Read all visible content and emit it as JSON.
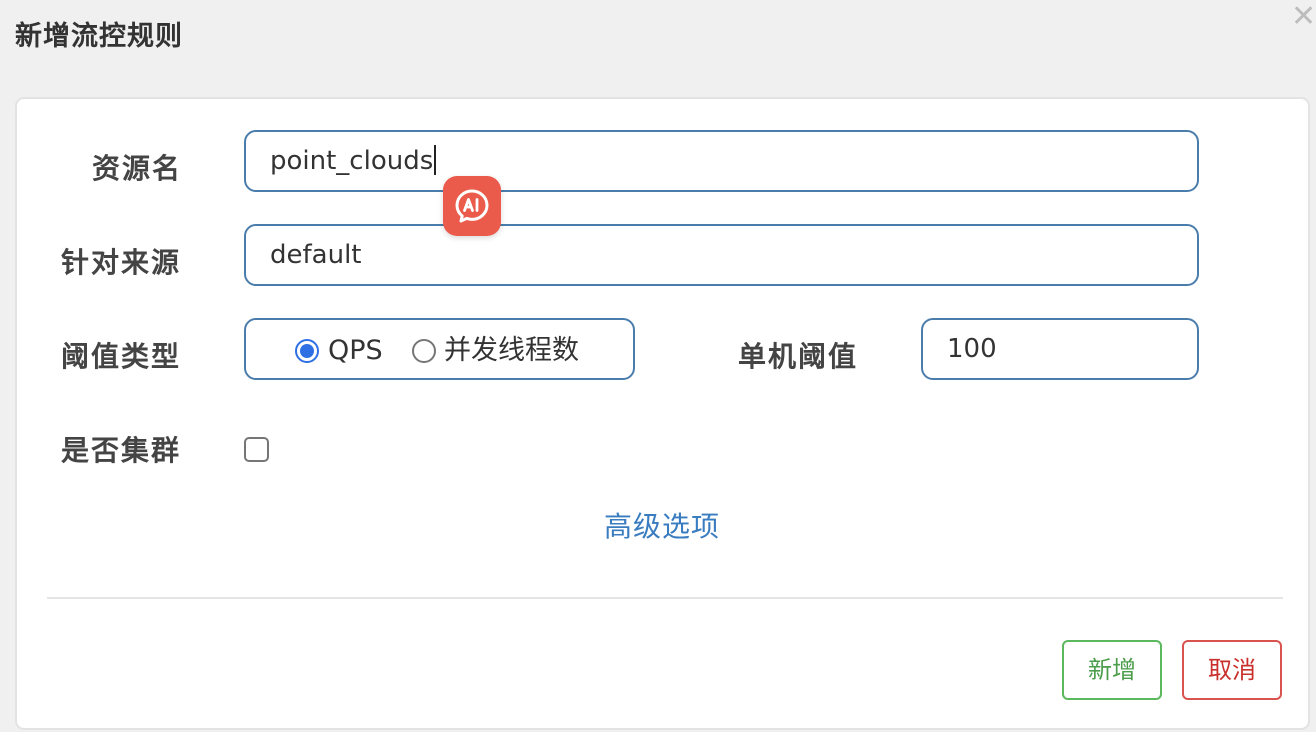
{
  "dialog": {
    "title": "新增流控规则",
    "close_glyph": "✕"
  },
  "form": {
    "resource": {
      "label": "资源名",
      "value": "point_clouds"
    },
    "limit_app": {
      "label": "针对来源",
      "value": "default"
    },
    "grade": {
      "label": "阈值类型",
      "options": [
        {
          "label": "QPS",
          "checked": true
        },
        {
          "label": "并发线程数",
          "checked": false
        }
      ]
    },
    "count": {
      "label": "单机阈值",
      "value": "100"
    },
    "cluster": {
      "label": "是否集群",
      "checked": false
    },
    "advanced_link": "高级选项"
  },
  "footer": {
    "add_label": "新增",
    "cancel_label": "取消"
  },
  "overlay": {
    "ai_badge_icon": "ai-chat-icon",
    "ai_badge_color": "#ea5b4b"
  },
  "colors": {
    "input_border": "#4a7dab",
    "link": "#3a7cc0",
    "add_button": "#5cb85c",
    "cancel_button": "#d9534f",
    "radio_checked": "#2f6fe4"
  }
}
